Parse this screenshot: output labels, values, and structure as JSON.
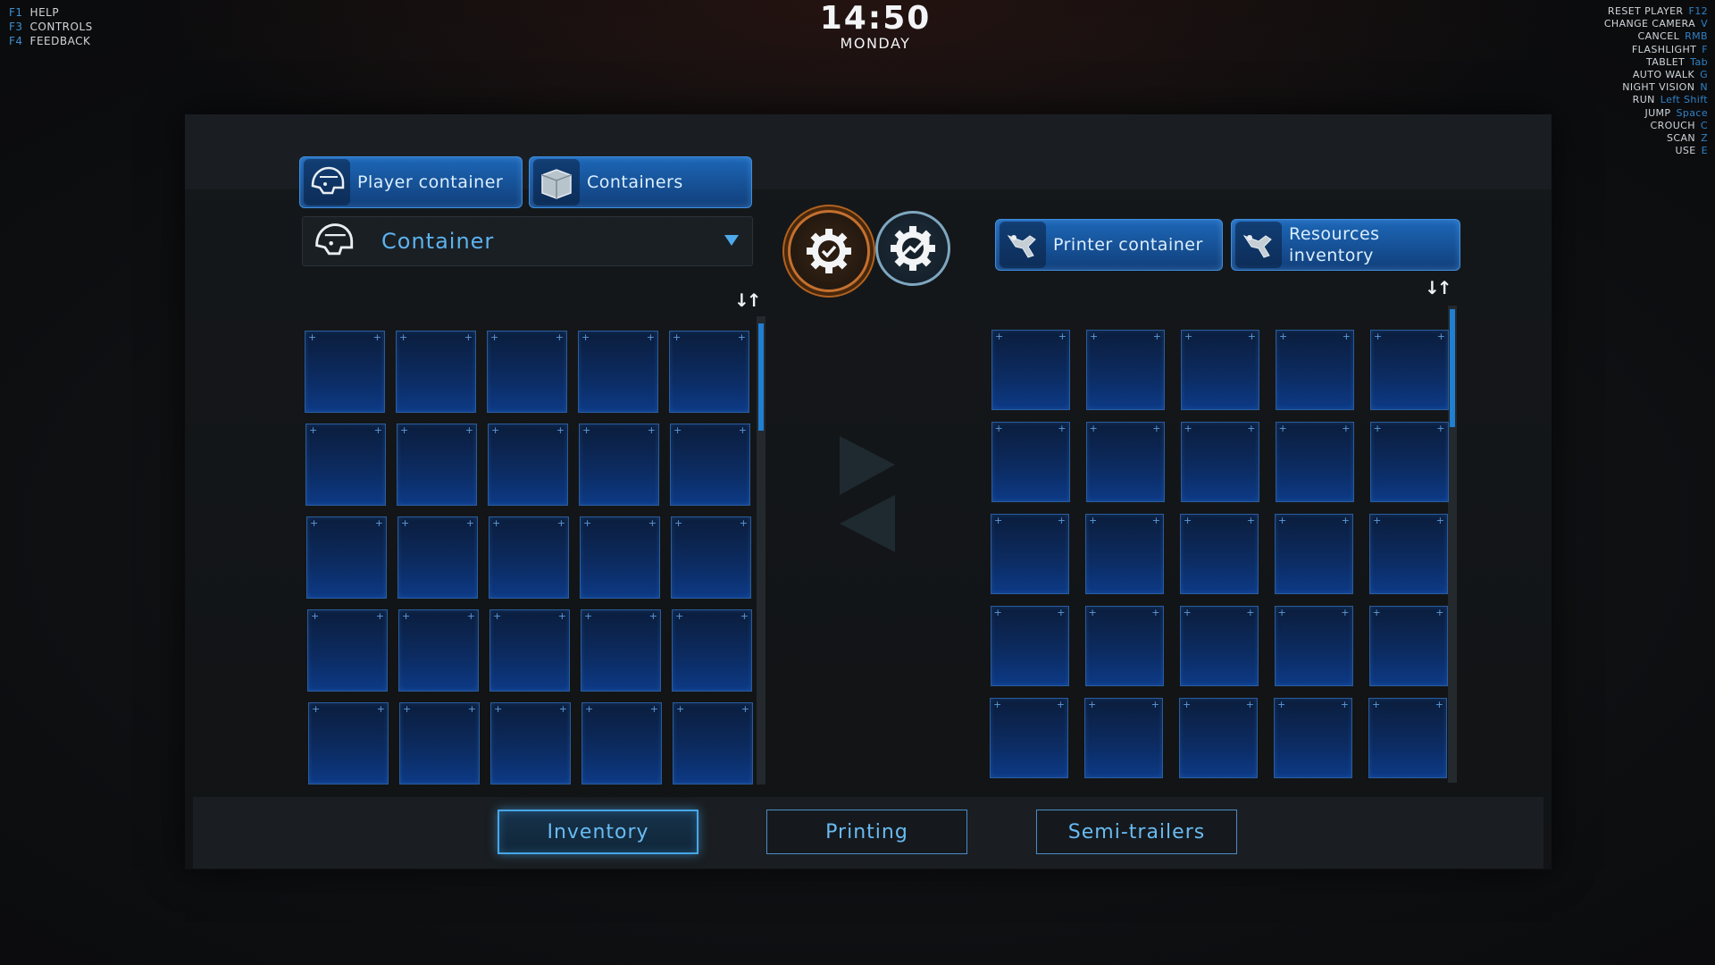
{
  "hotkeys_left": [
    {
      "key": "F1",
      "label": "HELP"
    },
    {
      "key": "F3",
      "label": "CONTROLS"
    },
    {
      "key": "F4",
      "label": "FEEDBACK"
    }
  ],
  "hotkeys_right": [
    {
      "label": "RESET PLAYER",
      "key": "F12"
    },
    {
      "label": "CHANGE CAMERA",
      "key": "V"
    },
    {
      "label": "CANCEL",
      "key": "RMB"
    },
    {
      "label": "FLASHLIGHT",
      "key": "F"
    },
    {
      "label": "TABLET",
      "key": "Tab"
    },
    {
      "label": "AUTO WALK",
      "key": "G"
    },
    {
      "label": "NIGHT VISION",
      "key": "N"
    },
    {
      "label": "RUN",
      "key": "Left Shift"
    },
    {
      "label": "JUMP",
      "key": "Space"
    },
    {
      "label": "CROUCH",
      "key": "C"
    },
    {
      "label": "SCAN",
      "key": "Z"
    },
    {
      "label": "USE",
      "key": "E"
    }
  ],
  "clock": {
    "time": "14:50",
    "day": "MONDAY"
  },
  "left_tabs": {
    "player_container": "Player container",
    "containers": "Containers"
  },
  "dropdown": {
    "label": "Container"
  },
  "right_tabs": {
    "printer_container": "Printer container",
    "resources_inventory": "Resources\ninventory"
  },
  "bottom_nav": {
    "inventory": "Inventory",
    "printing": "Printing",
    "semi_trailers": "Semi-trailers"
  },
  "colors": {
    "accent": "#1f7fd0",
    "slot": "#0c2c63",
    "confirm_ring": "#c4702f"
  }
}
